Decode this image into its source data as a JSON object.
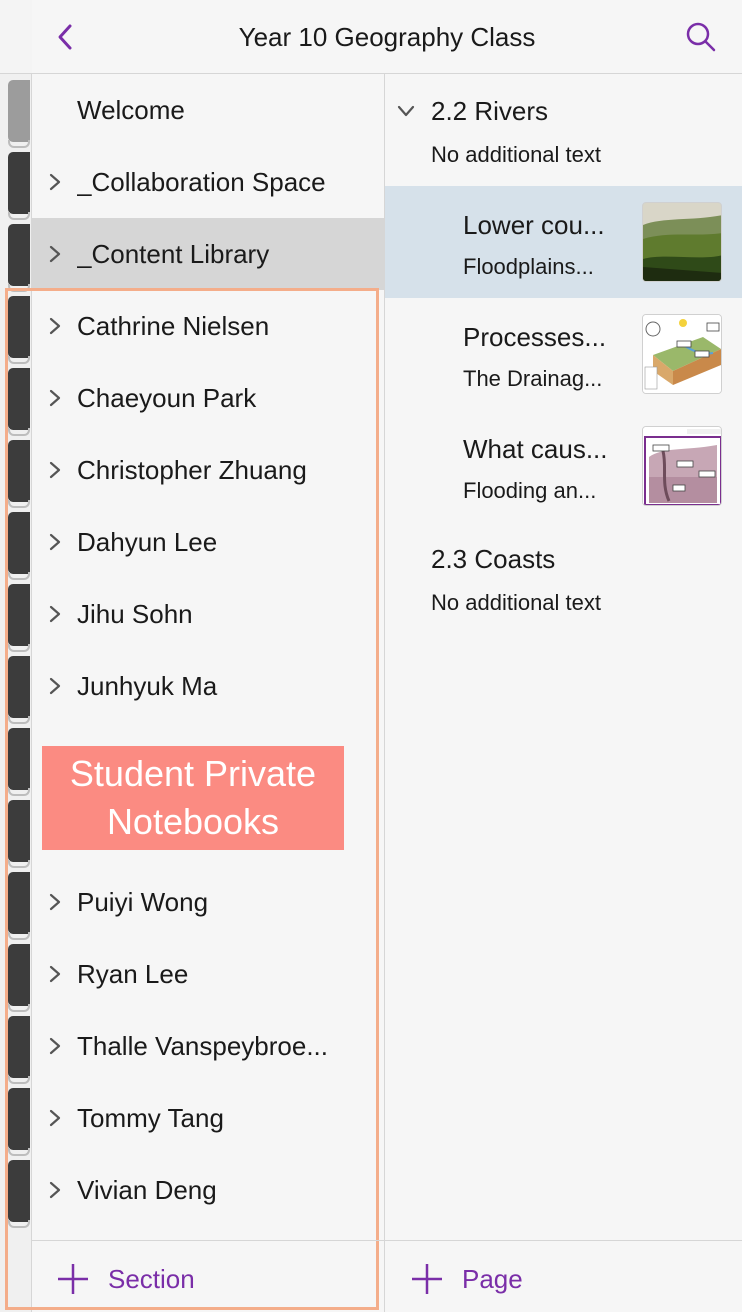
{
  "header": {
    "title": "Year 10 Geography Class",
    "back_icon": "chevron-left-icon",
    "search_icon": "search-icon",
    "accent_color": "#7a2ea8"
  },
  "sections": {
    "items": [
      {
        "label": "Welcome",
        "expandable": false,
        "selected": false
      },
      {
        "label": "_Collaboration Space",
        "expandable": true,
        "selected": false
      },
      {
        "label": "_Content Library",
        "expandable": true,
        "selected": true
      },
      {
        "label": "Cathrine Nielsen",
        "expandable": true,
        "selected": false
      },
      {
        "label": "Chaeyoun Park",
        "expandable": true,
        "selected": false
      },
      {
        "label": "Christopher Zhuang",
        "expandable": true,
        "selected": false
      },
      {
        "label": "Dahyun Lee",
        "expandable": true,
        "selected": false
      },
      {
        "label": "Jihu Sohn",
        "expandable": true,
        "selected": false
      },
      {
        "label": "Junhyuk Ma",
        "expandable": true,
        "selected": false
      },
      {
        "label": "Puiyi Wong",
        "expandable": true,
        "selected": false
      },
      {
        "label": "Ryan Lee",
        "expandable": true,
        "selected": false
      },
      {
        "label": "Thalle Vanspeybroe...",
        "expandable": true,
        "selected": false
      },
      {
        "label": "Tommy Tang",
        "expandable": true,
        "selected": false
      },
      {
        "label": "Vivian Deng",
        "expandable": true,
        "selected": false
      }
    ],
    "add_label": "Section"
  },
  "annotation": {
    "line1": "Student Private",
    "line2": "Notebooks",
    "color": "#fb8b82",
    "border_color": "#f4ad8a"
  },
  "pages": {
    "groups": [
      {
        "title": "2.2 Rivers",
        "subtitle": "No additional text",
        "expanded": true,
        "pages": [
          {
            "title": "Lower cou...",
            "subtitle": "Floodplains...",
            "selected": true
          },
          {
            "title": "Processes...",
            "subtitle": "The Drainag...",
            "selected": false
          },
          {
            "title": "What caus...",
            "subtitle": "Flooding an...",
            "selected": false
          }
        ]
      },
      {
        "title": "2.3 Coasts",
        "subtitle": "No additional text",
        "expanded": false,
        "pages": []
      }
    ],
    "add_label": "Page"
  }
}
